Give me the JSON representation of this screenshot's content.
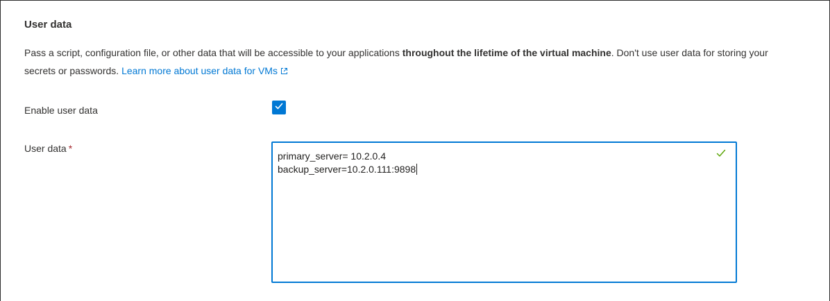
{
  "section": {
    "title": "User data",
    "description": {
      "part1": "Pass a script, configuration file, or other data that will be accessible to your applications ",
      "bold1": "throughout the lifetime of the virtual machine",
      "part2": ". Don't use user data for storing your secrets or passwords. ",
      "link": "Learn more about user data for VMs"
    }
  },
  "enable_user_data": {
    "label": "Enable user data",
    "checked": true
  },
  "user_data": {
    "label": "User data",
    "required_marker": "*",
    "lines": [
      "primary_server= 10.2.0.4",
      "backup_server=10.2.0.111:9898"
    ],
    "validation": "valid"
  },
  "icons": {
    "external_link": "external-link-icon",
    "checkmark": "checkmark-icon",
    "validation": "check-icon"
  },
  "colors": {
    "accent": "#0078d4",
    "required": "#a4262c",
    "valid": "#57a300",
    "text": "#323130"
  }
}
